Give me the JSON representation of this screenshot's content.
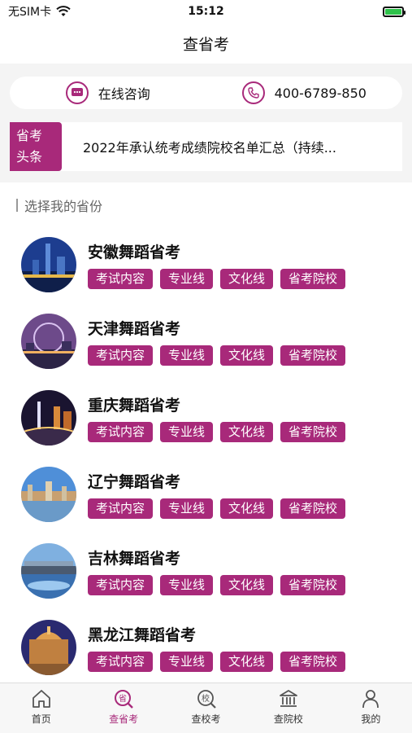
{
  "status_bar": {
    "carrier": "无SIM卡",
    "time": "15:12"
  },
  "nav": {
    "title": "查省考"
  },
  "contact": {
    "consult_label": "在线咨询",
    "phone": "400-6789-850"
  },
  "headline": {
    "tag_line1": "省考",
    "tag_line2": "头条",
    "text": "2022年承认统考成绩院校名单汇总（持续..."
  },
  "section": {
    "title": "选择我的省份"
  },
  "provinces": [
    {
      "name": "安徽舞蹈省考"
    },
    {
      "name": "天津舞蹈省考"
    },
    {
      "name": "重庆舞蹈省考"
    },
    {
      "name": "辽宁舞蹈省考"
    },
    {
      "name": "吉林舞蹈省考"
    },
    {
      "name": "黑龙江舞蹈省考"
    }
  ],
  "chips": {
    "exam_content": "考试内容",
    "major_line": "专业线",
    "culture_line": "文化线",
    "schools": "省考院校"
  },
  "tabs": [
    {
      "label": "首页",
      "icon": "home-icon"
    },
    {
      "label": "查省考",
      "icon": "province-exam-icon"
    },
    {
      "label": "查校考",
      "icon": "school-exam-icon"
    },
    {
      "label": "查院校",
      "icon": "college-icon"
    },
    {
      "label": "我的",
      "icon": "user-icon"
    }
  ],
  "colors": {
    "accent": "#a8297a",
    "background_gray": "#f4f4f4"
  }
}
